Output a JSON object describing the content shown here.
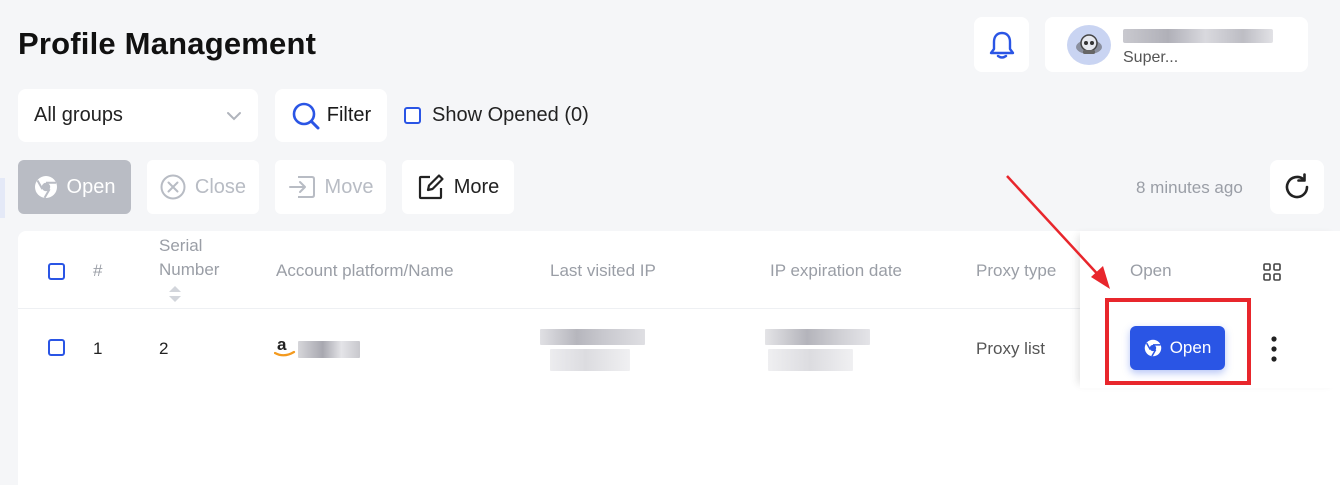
{
  "page": {
    "title": "Profile Management"
  },
  "header": {
    "user": {
      "name": "",
      "role": "Super..."
    }
  },
  "toolbar": {
    "group_select": "All groups",
    "filter_label": "Filter",
    "show_opened_label": "Show Opened (0)",
    "open_label": "Open",
    "close_label": "Close",
    "move_label": "Move",
    "more_label": "More",
    "last_updated": "8 minutes ago"
  },
  "table": {
    "columns": {
      "index": "#",
      "serial_line1": "Serial",
      "serial_line2": "Number",
      "platform": "Account platform/Name",
      "last_ip": "Last visited IP",
      "ip_expiration": "IP expiration date",
      "proxy_type": "Proxy type",
      "open": "Open"
    },
    "rows": [
      {
        "index": "1",
        "serial": "2",
        "platform_icon": "amazon-icon",
        "name": "",
        "last_ip": "",
        "ip_expiration": "",
        "proxy_type": "Proxy list",
        "open_label": "Open"
      }
    ]
  },
  "colors": {
    "primary": "#2a55e5",
    "highlight": "#e8262c",
    "background": "#f5f6f8",
    "muted_text": "#9a9ea6",
    "disabled_button": "#b9bcc4"
  },
  "icons": [
    "bell-icon",
    "chevron-down-icon",
    "search-icon",
    "chrome-icon",
    "close-circle-icon",
    "move-icon",
    "edit-icon",
    "refresh-icon",
    "sort-icon",
    "grid-icon",
    "more-vertical-icon",
    "amazon-icon"
  ]
}
